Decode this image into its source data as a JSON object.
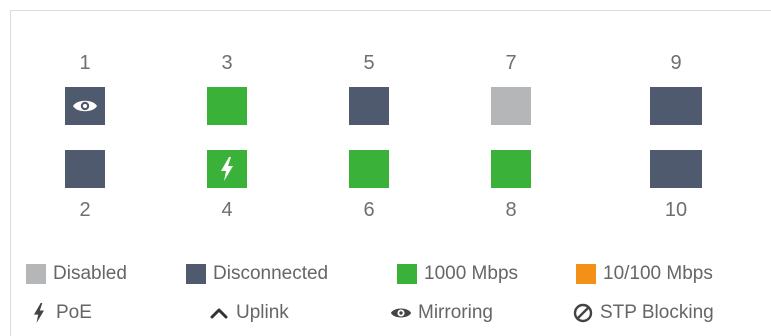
{
  "colors": {
    "disabled": "#b4b6b8",
    "disconnected": "#4f5a6e",
    "speed_1000": "#3ab23a",
    "speed_10_100": "#f39018",
    "text": "#666666",
    "port_number": "#6f6f6f"
  },
  "ports": [
    {
      "number": "1",
      "status": "disconnected",
      "icon": "eye-icon",
      "feature": "mirroring"
    },
    {
      "number": "2",
      "status": "disconnected",
      "icon": "",
      "feature": ""
    },
    {
      "number": "3",
      "status": "1000 Mbps",
      "icon": "",
      "feature": ""
    },
    {
      "number": "4",
      "status": "1000 Mbps",
      "icon": "lightning-bolt-icon",
      "feature": "poe"
    },
    {
      "number": "5",
      "status": "disconnected",
      "icon": "",
      "feature": ""
    },
    {
      "number": "6",
      "status": "1000 Mbps",
      "icon": "",
      "feature": ""
    },
    {
      "number": "7",
      "status": "disabled",
      "icon": "",
      "feature": ""
    },
    {
      "number": "8",
      "status": "1000 Mbps",
      "icon": "",
      "feature": ""
    },
    {
      "number": "9",
      "status": "disconnected",
      "icon": "",
      "feature": ""
    },
    {
      "number": "10",
      "status": "disconnected",
      "icon": "",
      "feature": ""
    }
  ],
  "legend": {
    "disabled": "Disabled",
    "disconnected": "Disconnected",
    "speed_1000": "1000 Mbps",
    "speed_10_100": "10/100 Mbps",
    "poe": "PoE",
    "uplink": "Uplink",
    "mirroring": "Mirroring",
    "stp_blocking": "STP Blocking"
  }
}
